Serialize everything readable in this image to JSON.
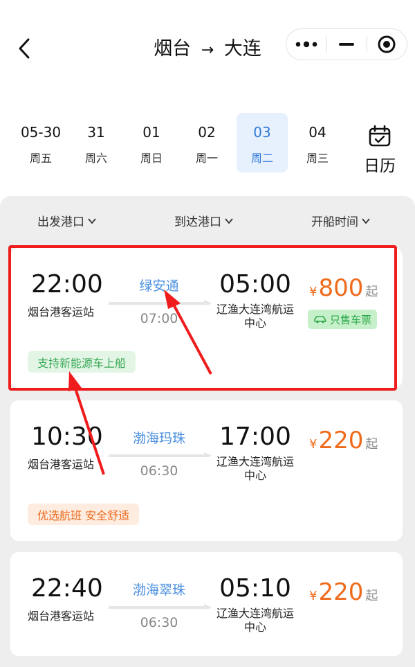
{
  "header": {
    "title_from": "烟台",
    "title_arrow": "→",
    "title_to": "大连"
  },
  "dates": [
    {
      "date": "05-30",
      "weekday": "周五",
      "active": false
    },
    {
      "date": "31",
      "weekday": "周六",
      "active": false
    },
    {
      "date": "01",
      "weekday": "周日",
      "active": false
    },
    {
      "date": "02",
      "weekday": "周一",
      "active": false
    },
    {
      "date": "03",
      "weekday": "周二",
      "active": true
    },
    {
      "date": "04",
      "weekday": "周三",
      "active": false
    }
  ],
  "calendar_label": "日历",
  "filters": {
    "departure_port": "出发港口",
    "arrival_port": "到达港口",
    "sail_time": "开船时间"
  },
  "trips": [
    {
      "dep_time": "22:00",
      "dep_port": "烟台港客运站",
      "ship": "绿安通",
      "duration": "07:00",
      "arr_time": "05:00",
      "arr_port_line1": "辽渔大连湾航运",
      "arr_port_line2": "中心",
      "currency": "¥",
      "price": "800",
      "price_suffix": "起",
      "ticket_tag": "只售车票",
      "badge": "支持新能源车上船"
    },
    {
      "dep_time": "10:30",
      "dep_port": "烟台港客运站",
      "ship": "渤海玛珠",
      "duration": "06:30",
      "arr_time": "17:00",
      "arr_port_line1": "辽渔大连湾航运",
      "arr_port_line2": "中心",
      "currency": "¥",
      "price": "220",
      "price_suffix": "起",
      "badge": "优选航班 安全舒适"
    },
    {
      "dep_time": "22:40",
      "dep_port": "烟台港客运站",
      "ship": "渤海翠珠",
      "duration": "06:30",
      "arr_time": "05:10",
      "arr_port_line1": "辽渔大连湾航运",
      "arr_port_line2": "中心",
      "currency": "¥",
      "price": "220",
      "price_suffix": "起"
    }
  ],
  "colors": {
    "accent_blue": "#2f7ad6",
    "price_orange": "#ef6a1b",
    "highlight_red": "#ee1c1c",
    "tag_green": "#2ea84c"
  },
  "icons": [
    "back-arrow-icon",
    "more-dots-icon",
    "minimize-icon",
    "close-target-icon",
    "calendar-icon",
    "chevron-down-icon",
    "car-icon"
  ]
}
